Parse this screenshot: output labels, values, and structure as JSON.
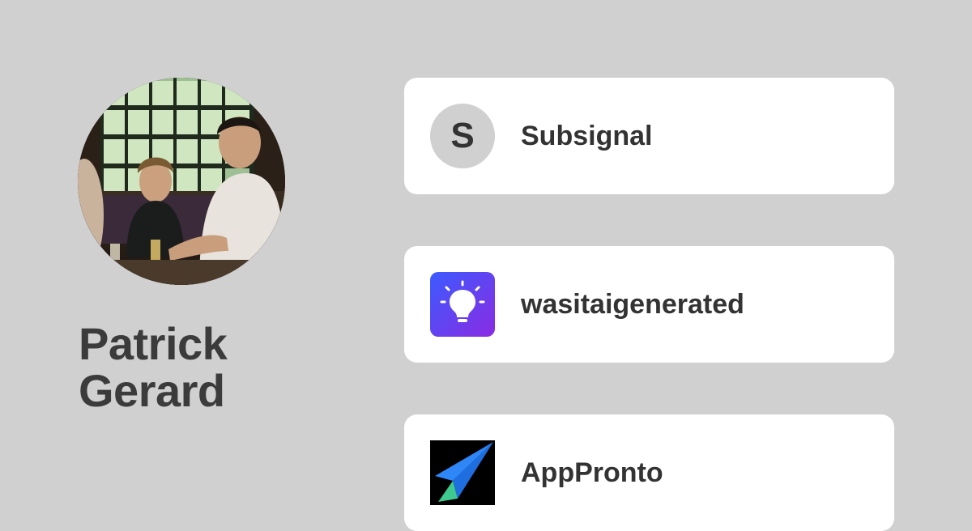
{
  "profile": {
    "first_name": "Patrick",
    "last_name": "Gerard",
    "avatar_icon": "profile-photo"
  },
  "links": [
    {
      "label": "Subsignal",
      "logo_text": "S",
      "logo_icon": "letter-avatar"
    },
    {
      "label": "wasitaigenerated",
      "logo_icon": "lightbulb-icon"
    },
    {
      "label": "AppPronto",
      "logo_icon": "paper-plane-icon"
    }
  ],
  "colors": {
    "background": "#d0d0d0",
    "card": "#ffffff",
    "text": "#333333",
    "name_text": "#3b3b3b",
    "bulb_gradient_start": "#3b5bff",
    "bulb_gradient_end": "#8a2be2",
    "plane_blue": "#2f86f6",
    "plane_green": "#3ec98f"
  }
}
